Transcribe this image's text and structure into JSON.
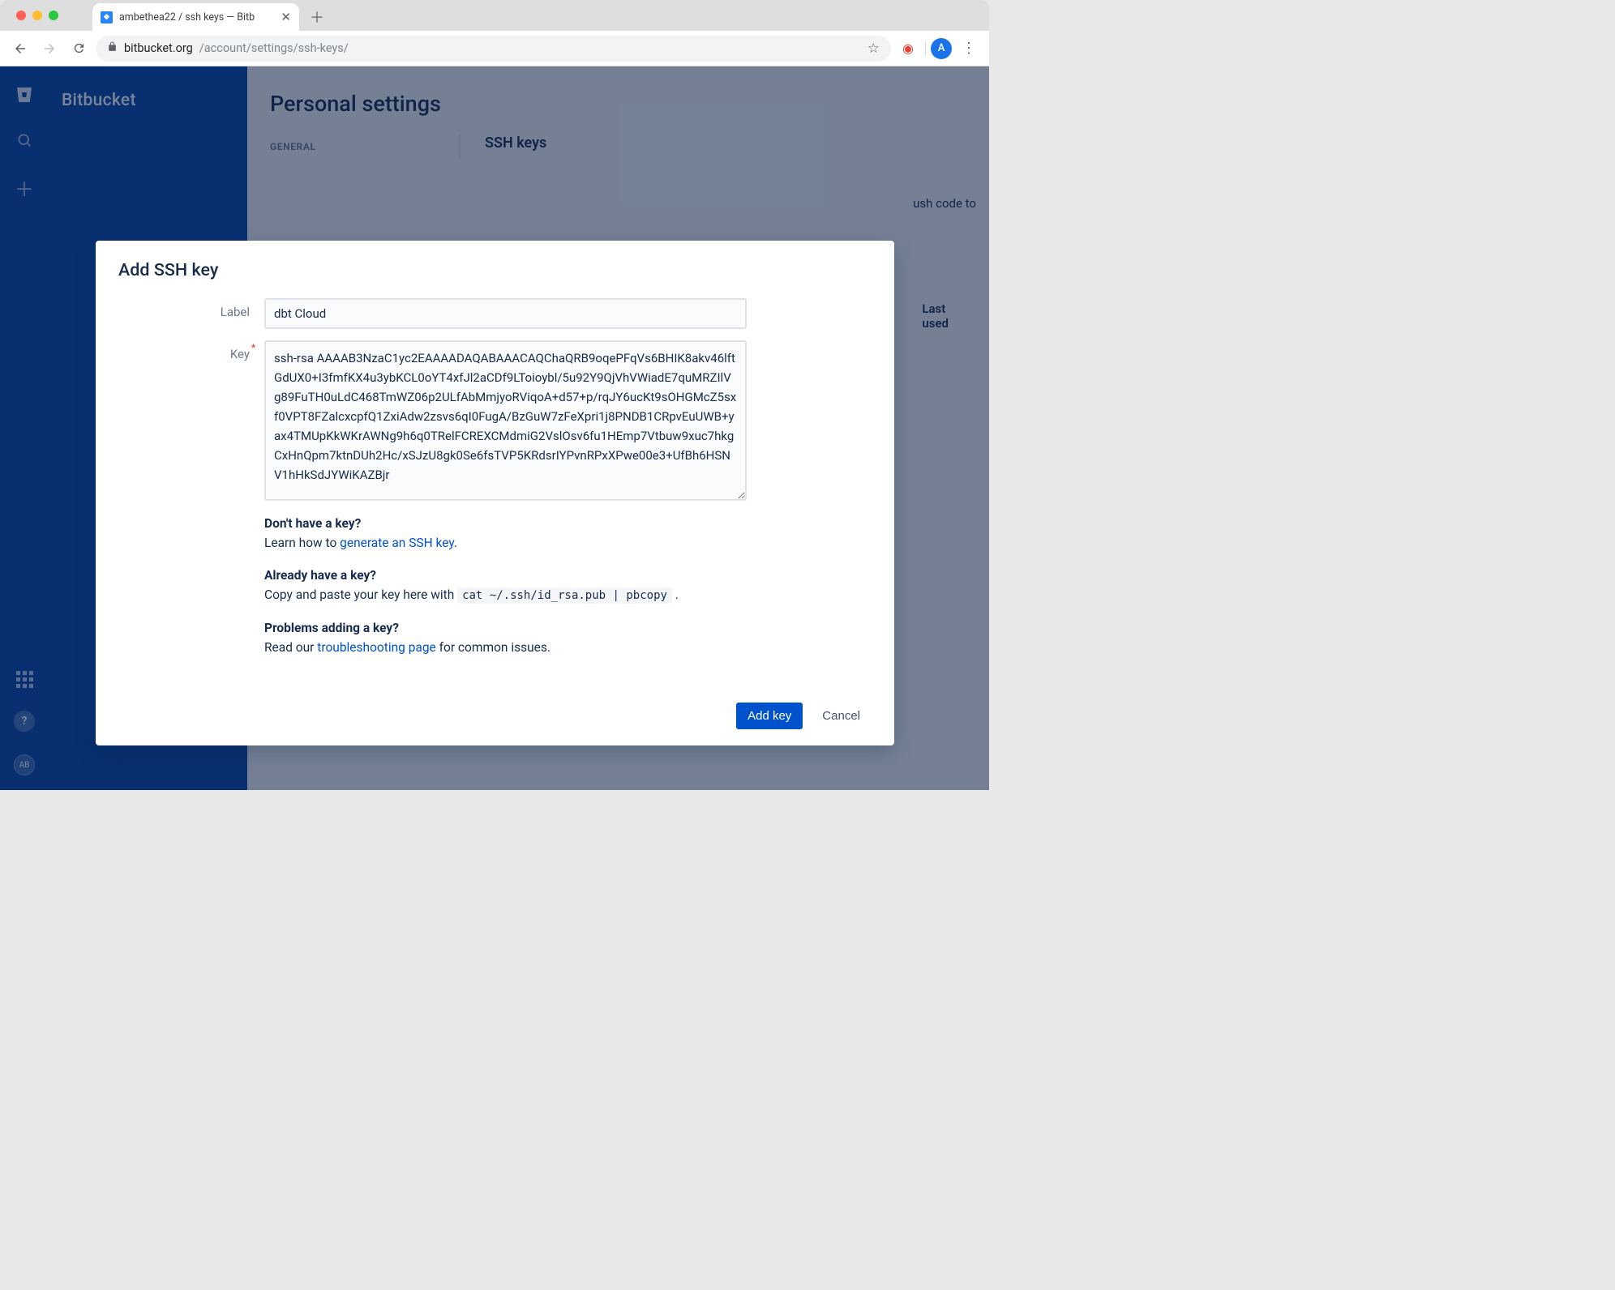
{
  "browser": {
    "tab_title": "ambethea22 / ssh keys — Bitb",
    "url_host": "bitbucket.org",
    "url_path": "/account/settings/ssh-keys/",
    "avatar_letter": "A"
  },
  "leftnav": {
    "user_initials": "AB"
  },
  "sidebar": {
    "brand": "Bitbucket"
  },
  "page": {
    "title": "Personal settings",
    "section_tab": "GENERAL",
    "right_heading": "SSH keys",
    "right_desc_fragment": "ush code to",
    "table_col1": "Last",
    "table_col2": "used"
  },
  "modal": {
    "title": "Add SSH key",
    "label_field_label": "Label",
    "label_value": "dbt Cloud",
    "key_field_label": "Key",
    "key_value": "ssh-rsa AAAAB3NzaC1yc2EAAAADAQABAAACAQChaQRB9oqePFqVs6BHIK8akv46lftGdUX0+I3fmfKX4u3ybKCL0oYT4xfJl2aCDf9LToioybl/5u92Y9QjVhVWiadE7quMRZIlVg89FuTH0uLdC468TmWZ06p2ULfAbMmjyoRViqoA+d57+p/rqJY6ucKt9sOHGMcZ5sxf0VPT8FZalcxcpfQ1ZxiAdw2zsvs6qI0FugA/BzGuW7zFeXpri1j8PNDB1CRpvEuUWB+yax4TMUpKkWKrAWNg9h6q0TRelFCREXCMdmiG2VslOsv6fu1HEmp7Vtbuw9xuc7hkgCxHnQpm7ktnDUh2Hc/xSJzU8gk0Se6fsTVP5KRdsrIYPvnRPxXPwe00e3+UfBh6HSNV1hHkSdJYWiKAZBjr",
    "help": {
      "no_key_heading": "Don't have a key?",
      "no_key_prefix": "Learn how to ",
      "no_key_link": "generate an SSH key",
      "no_key_suffix": ".",
      "have_key_heading": "Already have a key?",
      "have_key_text_prefix": "Copy and paste your key here with ",
      "have_key_cmd": "cat ~/.ssh/id_rsa.pub | pbcopy",
      "have_key_text_suffix": " .",
      "problems_heading": "Problems adding a key?",
      "problems_prefix": "Read our ",
      "problems_link": "troubleshooting page",
      "problems_suffix": " for common issues."
    },
    "primary_button": "Add key",
    "cancel_button": "Cancel"
  }
}
